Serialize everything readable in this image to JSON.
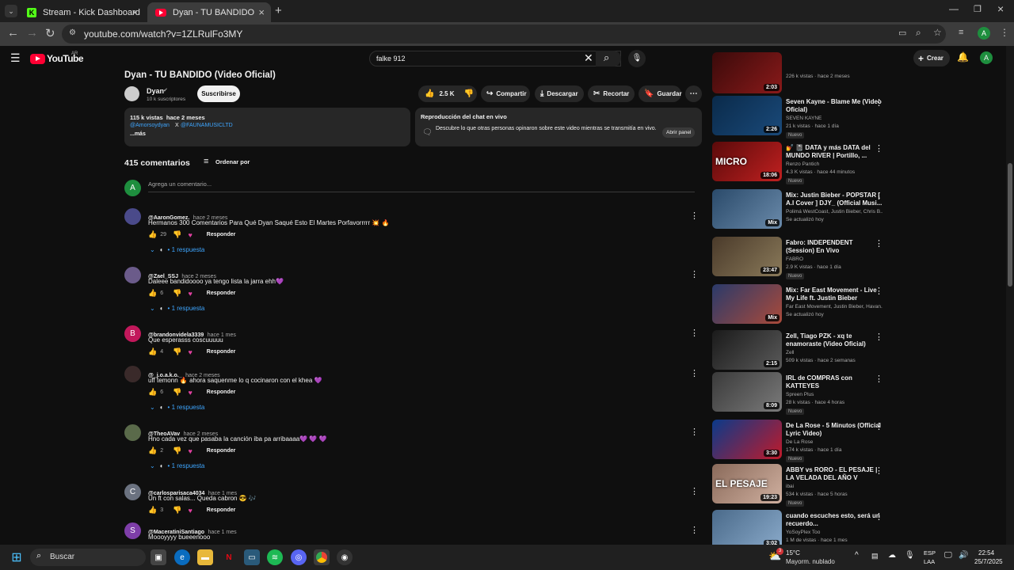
{
  "browser": {
    "tabs": [
      {
        "title": "Stream - Kick Dashboard",
        "icon": "kick-icon"
      },
      {
        "title": "Dyan - TU BANDIDO (Video",
        "icon": "youtube-icon"
      }
    ],
    "url": "youtube.com/watch?v=1ZLRulFo3MY"
  },
  "yt": {
    "country": "AR",
    "logo_text": "YouTube",
    "search_value": "falke 912",
    "create_label": "Crear",
    "account_initial": "A"
  },
  "video": {
    "title": "Dyan - TU BANDIDO (Video Oficial)",
    "channel": "Dyan",
    "subscribers": "10 k suscriptores",
    "subscribe_label": "Suscribirse",
    "likes": "2.5 K",
    "share_label": "Compartir",
    "download_label": "Descargar",
    "clip_label": "Recortar",
    "save_label": "Guardar",
    "views_date": "115 k vistas  hace 2 meses",
    "desc_link1": "@Amorsoydyan",
    "desc_x": "X",
    "desc_link2": "@FAUNAMUSICLTD",
    "more_label": "...más",
    "chat_title": "Reproducción del chat en vivo",
    "chat_text": "Descubre lo que otras personas opinaron sobre este video mientras se transmitía en vivo.",
    "chat_button": "Abrir panel"
  },
  "comments_header": {
    "count": "415 comentarios",
    "sort_label": "Ordenar por",
    "add_placeholder": "Agrega un comentario...",
    "user_initial": "A"
  },
  "comments": [
    {
      "author": "@AaronGomez.",
      "time": "hace 2 meses",
      "text": "Hermanos 300 Comentarios Para Qué Dyan Saqué Esto El Martes Porfavorrrrr 💥 🔥",
      "likes": "29",
      "reply_label": "Responder",
      "replies": "1 respuesta",
      "avatar_color": "#4a4a8a",
      "initial": ""
    },
    {
      "author": "@Zael_SSJ",
      "time": "hace 2 meses",
      "text": "Daleee bandidoooo ya tengo lista la jarra ehh💜",
      "likes": "6",
      "reply_label": "Responder",
      "replies": "1 respuesta",
      "avatar_color": "#6b5b8a",
      "initial": ""
    },
    {
      "author": "@brandonvidela3339",
      "time": "hace 1 mes",
      "text": "Que esperasss coscuuuuu",
      "likes": "4",
      "reply_label": "Responder",
      "replies": "",
      "avatar_color": "#c2185b",
      "initial": "B"
    },
    {
      "author": "@_j.o.a.k.o._",
      "time": "hace 2 meses",
      "text": "uff temonn 🔥 ahora saquenme lo q cocinaron con el khea 💜",
      "likes": "6",
      "reply_label": "Responder",
      "replies": "1 respuesta",
      "avatar_color": "#3a2a2a",
      "initial": ""
    },
    {
      "author": "@TheoAVav",
      "time": "hace 2 meses",
      "text": "Hno cada vez que pasaba la canción iba pa arribaaaa💜 💜 💜",
      "likes": "2",
      "reply_label": "Responder",
      "replies": "1 respuesta",
      "avatar_color": "#5a6a4a",
      "initial": ""
    },
    {
      "author": "@carlosparisaca4034",
      "time": "hace 1 mes",
      "text": "Un ft con salas... Queda cabron 😎 🎶",
      "likes": "3",
      "reply_label": "Responder",
      "replies": "",
      "avatar_color": "#6b7280",
      "initial": "C"
    },
    {
      "author": "@MaceratiniSantiago",
      "time": "hace 1 mes",
      "text": "Moooyyyy bueeenooo",
      "likes": "",
      "reply_label": "",
      "replies": "",
      "avatar_color": "#7e3ea8",
      "initial": "S"
    }
  ],
  "sidebar": {
    "first_meta": "226 k vistas · hace 2 meses",
    "first_duration": "2:03",
    "videos": [
      {
        "title": "Seven Kayne - Blame Me (Video Oficial)",
        "channel": "SEVEN KAYNE",
        "meta": "21 k vistas · hace 1 día",
        "duration": "2:26",
        "badge": "Nuevo",
        "colors": [
          "#0a2a4a",
          "#1a4a7a"
        ]
      },
      {
        "title": "💅 📓 DATA y más DATA del MUNDO RIVER | Portillo, ...",
        "channel": "Renzo Pantich",
        "meta": "4.3 K vistas · hace 44 minutos",
        "duration": "18:06",
        "badge": "Nuevo",
        "colors": [
          "#5a0a0a",
          "#c02020"
        ],
        "overlay": "MICRO"
      },
      {
        "title": "Mix: Justin Bieber - POPSTAR [ A.I Cover ] DJY_ (Official Musi...",
        "channel": "Polimá WestCoast, Justin Bieber, Chris B...",
        "meta": "Se actualizó hoy",
        "duration": "Mix",
        "badge": "",
        "colors": [
          "#2a4a6a",
          "#6a8aaa"
        ]
      },
      {
        "title": "Fabro: INDEPENDENT (Session) En Vivo",
        "channel": "FABRO",
        "meta": "2.9 K vistas · hace 1 día",
        "duration": "23:47",
        "badge": "Nuevo",
        "colors": [
          "#4a3a2a",
          "#8a7a5a"
        ]
      },
      {
        "title": "Mix: Far East Movement - Live My Life ft. Justin Bieber",
        "channel": "Far East Movement, Justin Bieber, Havan...",
        "meta": "Se actualizó hoy",
        "duration": "Mix",
        "badge": "",
        "colors": [
          "#2a3a6a",
          "#aa4a3a"
        ]
      },
      {
        "title": "Zell, Tiago PZK - xq te enamoraste (Video Oficial)",
        "channel": "Zell",
        "meta": "509 k vistas · hace 2 semanas",
        "duration": "2:15",
        "badge": "",
        "colors": [
          "#1a1a1a",
          "#5a5a5a"
        ]
      },
      {
        "title": "IRL de COMPRAS con KATTEYES",
        "channel": "Spreen Plus",
        "meta": "28 k vistas · hace 4 horas",
        "duration": "8:09",
        "badge": "Nuevo",
        "colors": [
          "#3a3a3a",
          "#7a7a7a"
        ]
      },
      {
        "title": "De La Rose - 5 Minutos (Official Lyric Video)",
        "channel": "De La Rose",
        "meta": "174 k vistas · hace 1 día",
        "duration": "3:30",
        "badge": "Nuevo",
        "colors": [
          "#0a3a8a",
          "#c01a2a"
        ]
      },
      {
        "title": "ABBY vs RORO - EL PESAJE | LA VELADA DEL AÑO V",
        "channel": "ibai",
        "meta": "534 k vistas · hace 5 horas",
        "duration": "19:23",
        "badge": "Nuevo",
        "colors": [
          "#8a6a5a",
          "#d0b0a0"
        ],
        "overlay": "EL PESAJE"
      },
      {
        "title": "cuando escuches esto, será un recuerdo...",
        "channel": "YoSoyPlex Too",
        "meta": "1 M de vistas · hace 1 mes",
        "duration": "3:02",
        "badge": "",
        "colors": [
          "#4a6a8a",
          "#8aaaca"
        ]
      }
    ]
  },
  "taskbar": {
    "search_placeholder": "Buscar",
    "weather_temp": "15°C",
    "weather_text": "Mayorm. nublado",
    "lang1": "ESP",
    "lang2": "LAA",
    "time": "22:54",
    "date": "25/7/2025",
    "notif_count": "3"
  }
}
